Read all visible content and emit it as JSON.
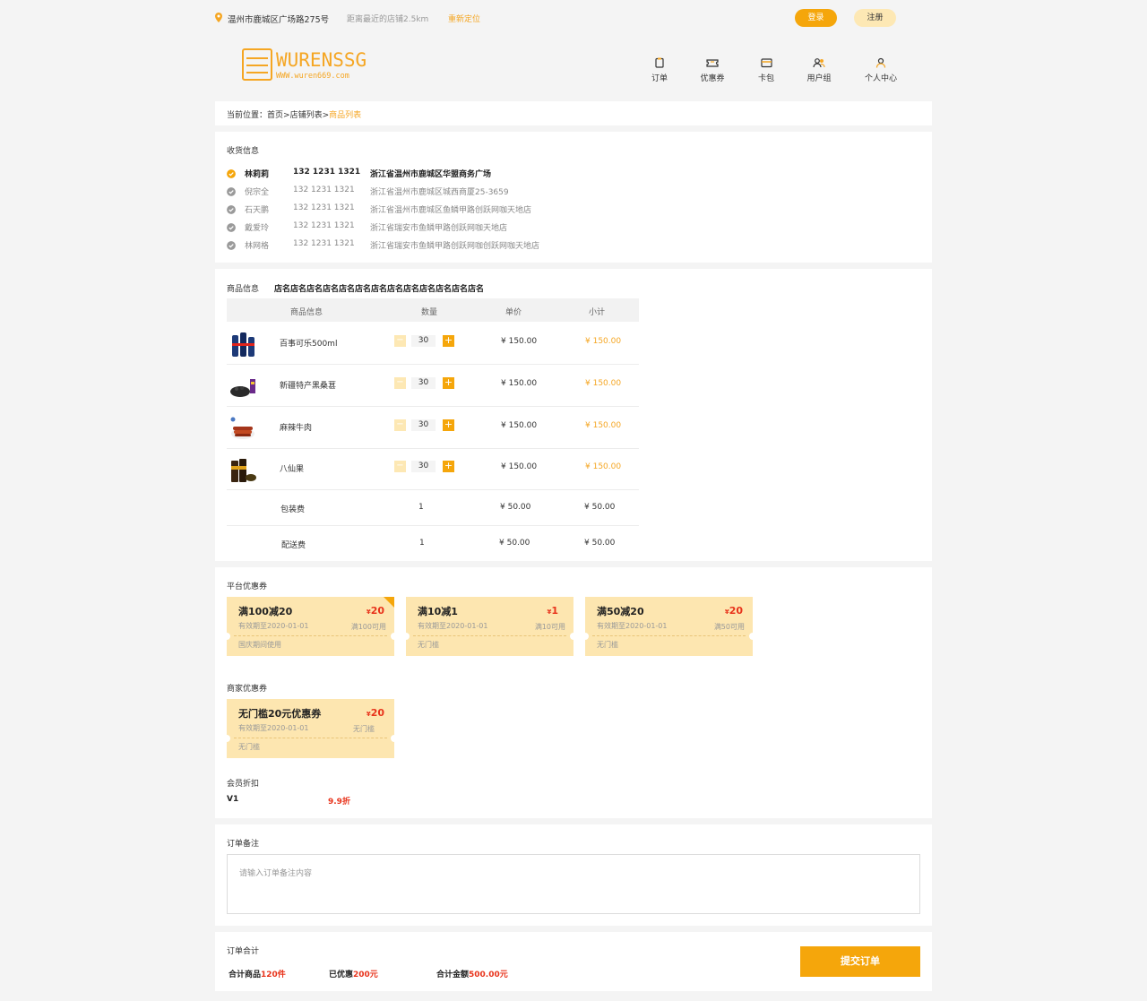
{
  "topbar": {
    "address": "温州市鹿城区广场路275号",
    "distance": "距离最近的店铺2.5km",
    "relocate": "重新定位",
    "login": "登录",
    "register": "注册"
  },
  "logo": {
    "title": "WURENSSG",
    "url": "WWW.wuren669.com"
  },
  "nav": [
    {
      "label": "订单",
      "icon": "order-icon"
    },
    {
      "label": "优惠券",
      "icon": "coupon-icon"
    },
    {
      "label": "卡包",
      "icon": "wallet-icon"
    },
    {
      "label": "用户组",
      "icon": "user-group-icon"
    },
    {
      "label": "个人中心",
      "icon": "user-icon"
    }
  ],
  "breadcrumb": {
    "prefix": "当前位置：",
    "home": "首页",
    "sep1": ">",
    "shops": "店铺列表",
    "sep2": ">",
    "current": "商品列表"
  },
  "address": {
    "title": "收货信息",
    "items": [
      {
        "name": "林莉莉",
        "phone": "132 1231 1321",
        "addr": "浙江省温州市鹿城区华盟商务广场",
        "selected": true
      },
      {
        "name": "倪宗全",
        "phone": "132 1231 1321",
        "addr": "浙江省温州市鹿城区城西商厦25-3659",
        "selected": false
      },
      {
        "name": "石天鹏",
        "phone": "132 1231 1321",
        "addr": "浙江省温州市鹿城区鱼鳞甲路创跃网咖天地店",
        "selected": false
      },
      {
        "name": "戴爱玲",
        "phone": "132 1231 1321",
        "addr": "浙江省瑞安市鱼鳞甲路创跃网咖天地店",
        "selected": false
      },
      {
        "name": "林网格",
        "phone": "132 1231 1321",
        "addr": "浙江省瑞安市鱼鳞甲路创跃网咖创跃网咖天地店",
        "selected": false
      }
    ]
  },
  "goods": {
    "title": "商品信息",
    "shop": "店名店名店名店名店名店名店名店名店名店名店名店名店名",
    "headers": {
      "info": "商品信息",
      "qty": "数量",
      "price": "单价",
      "subtotal": "小计"
    },
    "items": [
      {
        "name": "百事可乐500ml",
        "qty": "30",
        "price": "¥ 150.00",
        "subtotal": "¥ 150.00"
      },
      {
        "name": "新疆特产黑桑葚",
        "qty": "30",
        "price": "¥ 150.00",
        "subtotal": "¥ 150.00"
      },
      {
        "name": "麻辣牛肉",
        "qty": "30",
        "price": "¥ 150.00",
        "subtotal": "¥ 150.00"
      },
      {
        "name": "八仙果",
        "qty": "30",
        "price": "¥ 150.00",
        "subtotal": "¥ 150.00"
      }
    ],
    "fees": [
      {
        "name": "包装费",
        "qty": "1",
        "price": "¥ 50.00",
        "subtotal": "¥ 50.00"
      },
      {
        "name": "配送费",
        "qty": "1",
        "price": "¥ 50.00",
        "subtotal": "¥ 50.00"
      }
    ],
    "minus": "−",
    "plus": "+"
  },
  "platform_coupons": {
    "title": "平台优惠券",
    "items": [
      {
        "title": "满100减20",
        "currency": "¥",
        "amount": "20",
        "date": "有效期至2020-01-01",
        "cond": "满100可用",
        "note": "国庆期间使用",
        "selected": true
      },
      {
        "title": "满10减1",
        "currency": "¥",
        "amount": "1",
        "date": "有效期至2020-01-01",
        "cond": "满10可用",
        "note": "无门槛",
        "selected": false
      },
      {
        "title": "满50减20",
        "currency": "¥",
        "amount": "20",
        "date": "有效期至2020-01-01",
        "cond": "满50可用",
        "note": "无门槛",
        "selected": false
      }
    ]
  },
  "shop_coupons": {
    "title": "商家优惠券",
    "items": [
      {
        "title": "无门槛20元优惠券",
        "currency": "¥",
        "amount": "20",
        "date": "有效期至2020-01-01",
        "cond": "无门槛",
        "note": "无门槛",
        "selected": false
      }
    ]
  },
  "member": {
    "title": "会员折扣",
    "level": "V1",
    "discount": "9.9折"
  },
  "remark": {
    "title": "订单备注",
    "placeholder": "请输入订单备注内容"
  },
  "summary": {
    "title": "订单合计",
    "goods_label": "合计商品",
    "goods_value": "120件",
    "saved_label": "已优惠",
    "saved_value": "200元",
    "total_label": "合计金额",
    "total_value": "500.00元",
    "submit": "提交订单"
  },
  "colors": {
    "accent": "#f5a60b",
    "accent_light": "#fde8b4",
    "price_red": "#e8331b"
  }
}
